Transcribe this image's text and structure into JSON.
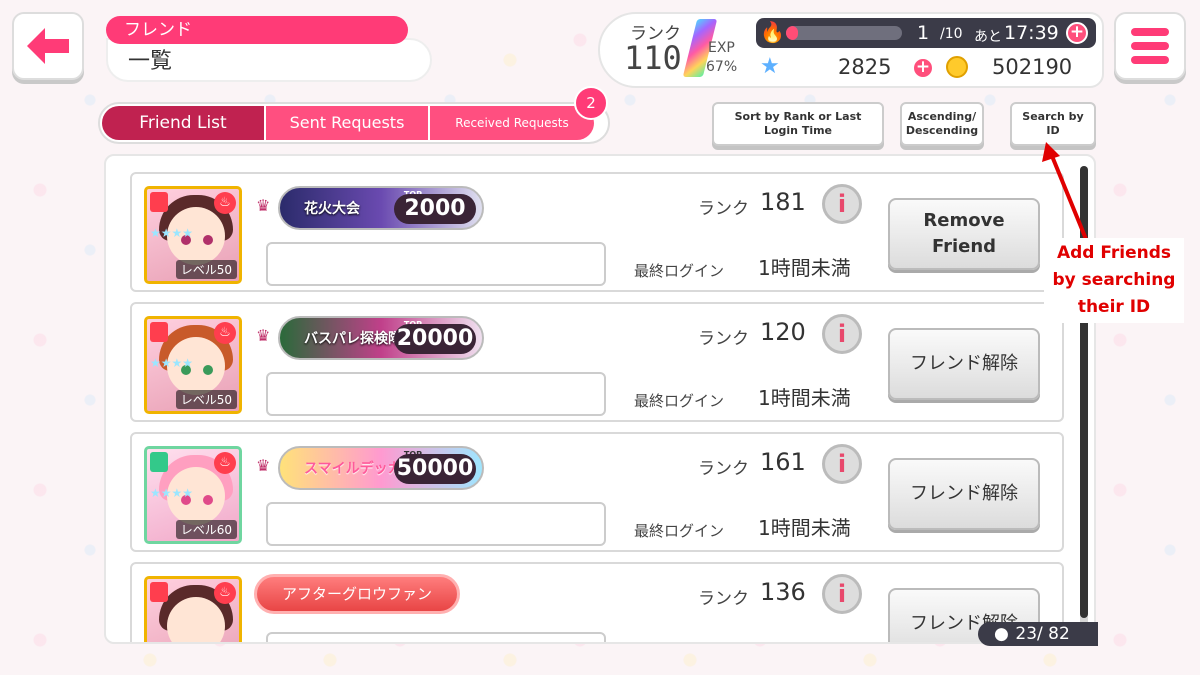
{
  "header": {
    "section_tag": "フレンド",
    "page_title": "一覧"
  },
  "status": {
    "rank_label": "ランク",
    "rank_value": "110",
    "exp_label": "EXP",
    "exp_percent": "67%",
    "exp_fraction": 0.67,
    "stamina_current": "1",
    "stamina_max": "/10",
    "stamina_fill": 0.1,
    "timer_label": "あと",
    "timer_value": "17:39",
    "star_gems": "2825",
    "coins": "502190",
    "plus_symbol": "+"
  },
  "tabs": [
    {
      "label": "Friend List",
      "selected": true
    },
    {
      "label": "Sent Requests"
    },
    {
      "label": "Received Requests"
    }
  ],
  "received_badge": "2",
  "buttons": {
    "sort": "Sort by Rank or Last Login Time",
    "order": "Ascending/ Descending",
    "search": "Search by ID"
  },
  "friends": [
    {
      "level": "レベル50",
      "banner": "花火大会",
      "banner_top": "TOP",
      "banner_score": "2000",
      "rank_label": "ランク",
      "rank": "181",
      "login_label": "最終ログイン",
      "login": "1時間未満",
      "action": "Remove Friend"
    },
    {
      "level": "レベル50",
      "banner": "バスパレ探検隊",
      "banner_top": "TOP",
      "banner_score": "20000",
      "rank_label": "ランク",
      "rank": "120",
      "login_label": "最終ログイン",
      "login": "1時間未満",
      "action": "フレンド解除"
    },
    {
      "level": "レベル60",
      "banner": "スマイルデッカー",
      "banner_top": "TOP",
      "banner_score": "50000",
      "rank_label": "ランク",
      "rank": "161",
      "login_label": "最終ログイン",
      "login": "1時間未満",
      "action": "フレンド解除"
    },
    {
      "level": "",
      "banner": "アフターグロウファン",
      "rank_label": "ランク",
      "rank": "136",
      "action": "フレンド解除"
    }
  ],
  "counter": {
    "current": "23/",
    "total": "82"
  },
  "annotation": {
    "text": "Add Friends by searching their ID",
    "color": "#e00000"
  },
  "colors": {
    "accent": "#ff3b77",
    "tab_selected": "#c02250",
    "tab": "#ff4f80"
  }
}
